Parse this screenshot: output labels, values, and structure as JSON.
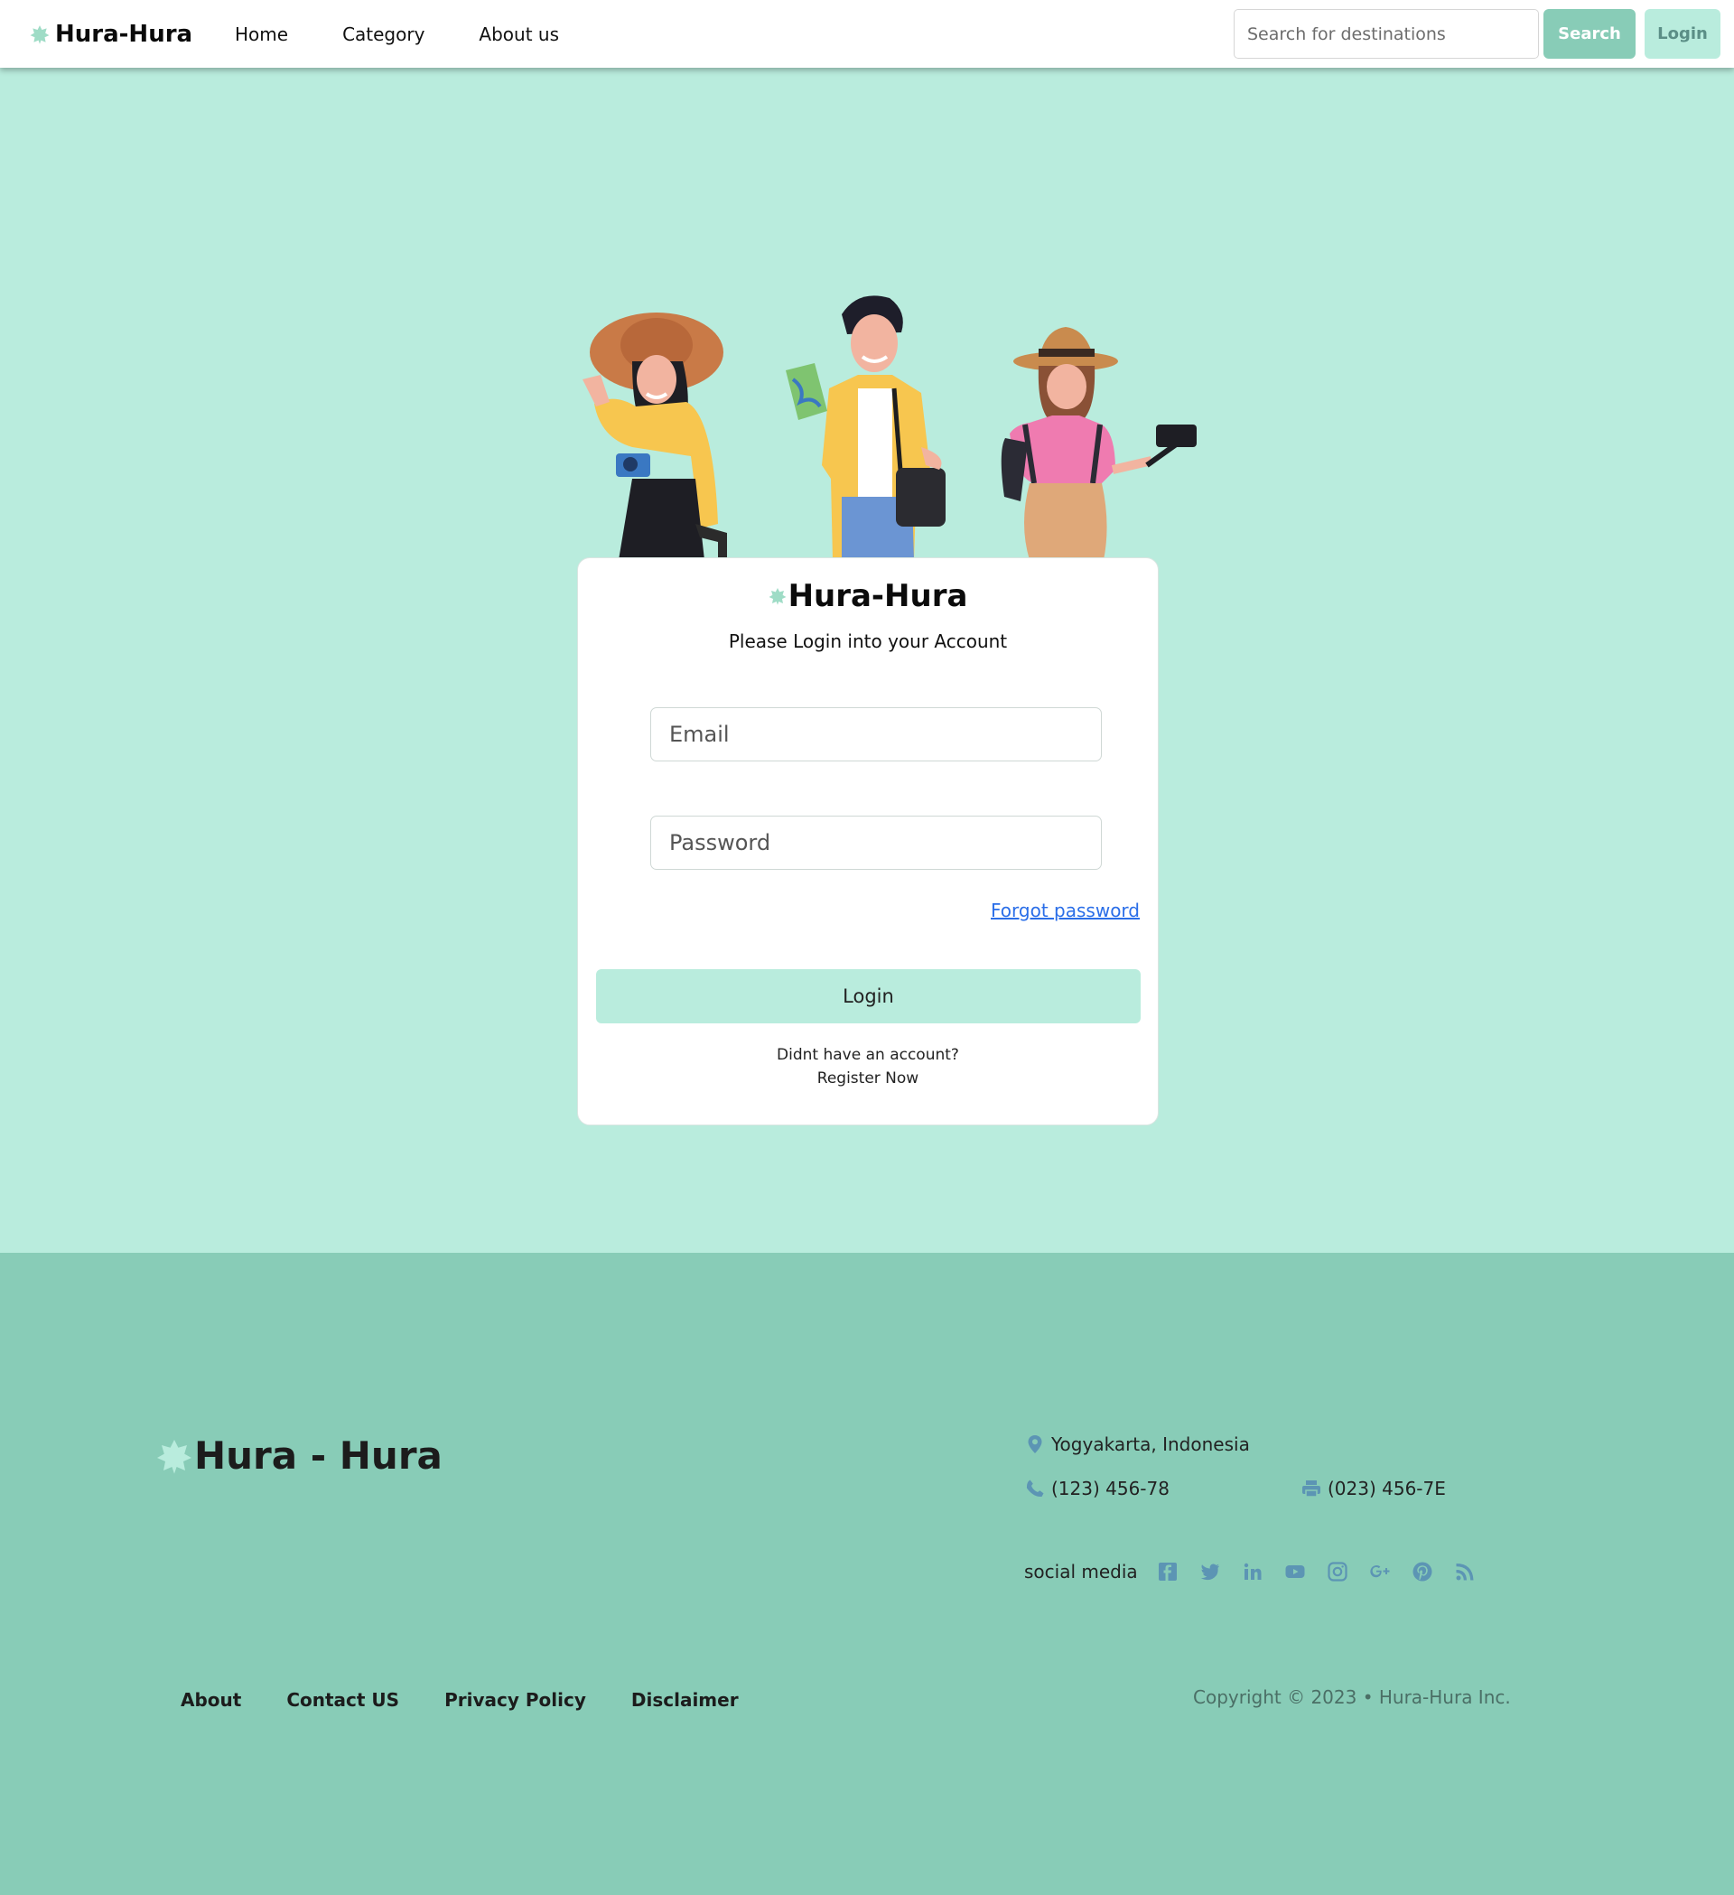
{
  "nav": {
    "brand": "Hura-Hura",
    "links": [
      "Home",
      "Category",
      "About us"
    ],
    "search_placeholder": "Search for destinations",
    "search_label": "Search",
    "login_label": "Login"
  },
  "login_card": {
    "brand": "Hura-Hura",
    "subtitle": "Please Login into your Account",
    "email_placeholder": "Email",
    "password_placeholder": "Password",
    "forgot_label": "Forgot password",
    "login_label": "Login",
    "no_account_text": "Didnt have an account?",
    "register_label": "Register Now"
  },
  "footer": {
    "brand": "Hura - Hura",
    "location": "Yogyakarta, Indonesia",
    "phone": "(123) 456-78",
    "fax": "(023) 456-7E",
    "social_label": "social media",
    "social_icons": [
      "facebook-icon",
      "twitter-icon",
      "linkedin-icon",
      "youtube-icon",
      "instagram-icon",
      "google-plus-icon",
      "pinterest-icon",
      "rss-icon"
    ],
    "links": [
      "About",
      "Contact US",
      "Privacy Policy",
      "Disclaimer"
    ],
    "copyright": "Copyright © 2023 • Hura-Hura Inc."
  },
  "colors": {
    "page_bg": "#b9ecdd",
    "footer_bg": "#88ccb7",
    "search_button": "#88ccb7",
    "login_button": "#b9ecdd",
    "link": "#2a6ee8",
    "social_icon": "#5c95b4"
  }
}
